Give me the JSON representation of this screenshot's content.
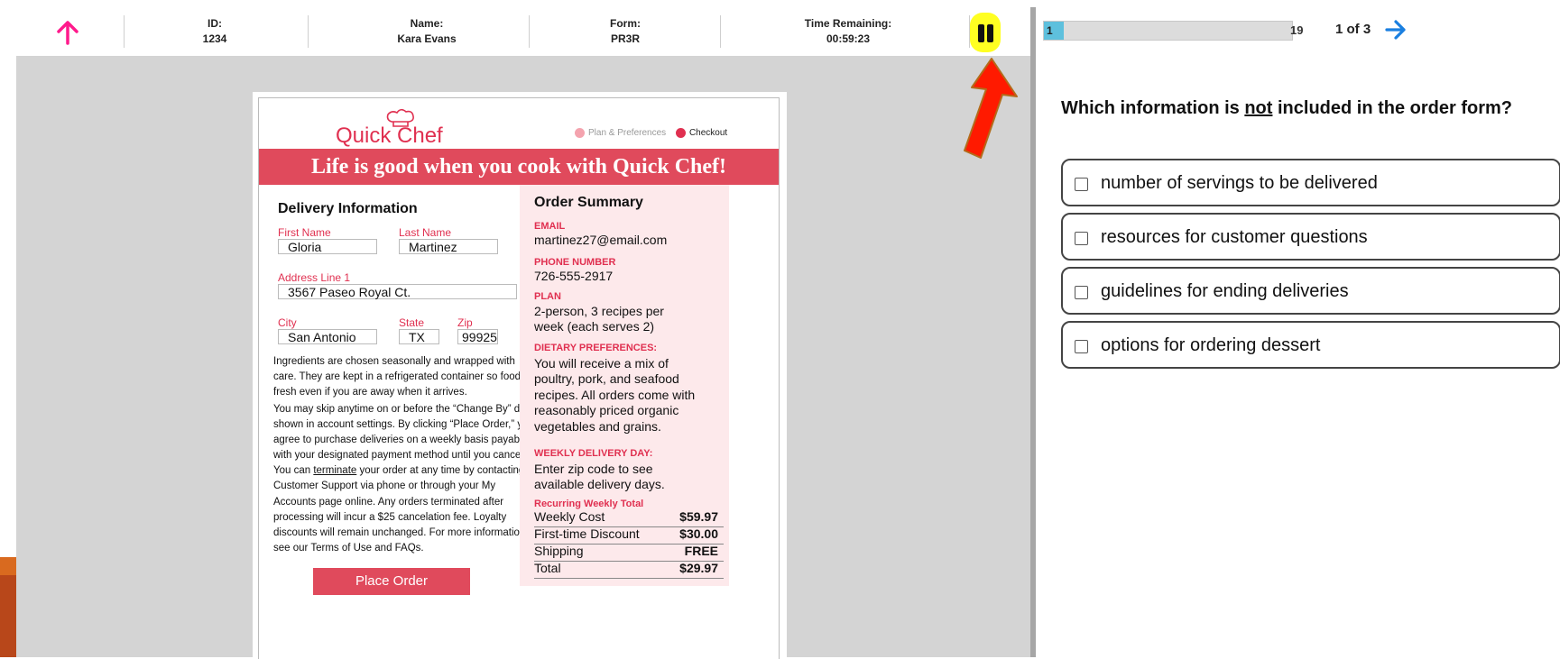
{
  "header": {
    "id_label": "ID:",
    "id_value": "1234",
    "name_label": "Name:",
    "name_value": "Kara Evans",
    "form_label": "Form:",
    "form_value": "PR3R",
    "time_label": "Time Remaining:",
    "time_value": "00:59:23"
  },
  "progress": {
    "current": "1",
    "total": "19",
    "fraction": 0.0526,
    "page_text": "1 of 3"
  },
  "question": {
    "prefix": "Which information is ",
    "emphasis": "not",
    "suffix": " included in the order form?"
  },
  "choices": [
    {
      "label": "number of servings to be delivered"
    },
    {
      "label": "resources for customer questions"
    },
    {
      "label": "guidelines for ending deliveries"
    },
    {
      "label": "options for ordering dessert"
    }
  ],
  "document": {
    "logo": "Quick Chef",
    "step1": "Plan & Preferences",
    "step2": "Checkout",
    "banner": "Life is good when you cook with Quick Chef!",
    "delivery_title": "Delivery Information",
    "first_name_label": "First Name",
    "first_name": "Gloria",
    "last_name_label": "Last Name",
    "last_name": "Martinez",
    "address_label": "Address Line 1",
    "address": "3567 Paseo Royal Ct.",
    "city_label": "City",
    "city": "San Antonio",
    "state_label": "State",
    "state": "TX",
    "zip_label": "Zip",
    "zip": "99925",
    "para1": "Ingredients are chosen seasonally and wrapped with care. They are kept in a refrigerated container so food is fresh even if you are away when it arrives.",
    "para2_a": "You may skip anytime on or before the “Change By” date shown in account settings. By clicking “Place Order,” you agree to purchase deliveries on a weekly basis payable with your designated payment method until you cancel. You can ",
    "para2_link": "terminate",
    "para2_b": " your order at any time by contacting Customer Support via phone or through your My Accounts page online. Any orders terminated after processing will incur a $25 cancelation fee. Loyalty discounts will remain unchanged. For more information, see our Terms of Use and FAQs.",
    "place_order": "Place Order",
    "summary_title": "Order Summary",
    "email_label": "EMAIL",
    "email": "martinez27@email.com",
    "phone_label": "PHONE NUMBER",
    "phone": "726-555-2917",
    "plan_label": "PLAN",
    "plan": "2-person, 3 recipes per week (each serves 2)",
    "diet_label": "DIETARY PREFERENCES:",
    "diet": "You will receive a mix of poultry, pork, and seafood recipes. All orders come with reasonably priced organic vegetables and grains.",
    "delivery_day_label": "WEEKLY DELIVERY DAY:",
    "delivery_day": "Enter zip code to see available delivery days.",
    "total_label": "Recurring Weekly Total",
    "rows": [
      {
        "label": "Weekly Cost",
        "amount": "$59.97"
      },
      {
        "label": "First-time Discount",
        "amount": "$30.00"
      },
      {
        "label": "Shipping",
        "amount": "FREE"
      },
      {
        "label": "Total",
        "amount": "$29.97"
      }
    ]
  },
  "colors": {
    "brand_red": "#e04a5c",
    "accent_pink": "#ff1a8c",
    "progress_fill": "#5ec0dd",
    "next_arrow": "#1a7fe0",
    "highlight": "#ffff22"
  },
  "icons": [
    "up-arrow-icon",
    "pause-icon",
    "right-arrow-icon",
    "chef-hat-icon",
    "check-circle-icon",
    "red-arrow-annotation"
  ]
}
